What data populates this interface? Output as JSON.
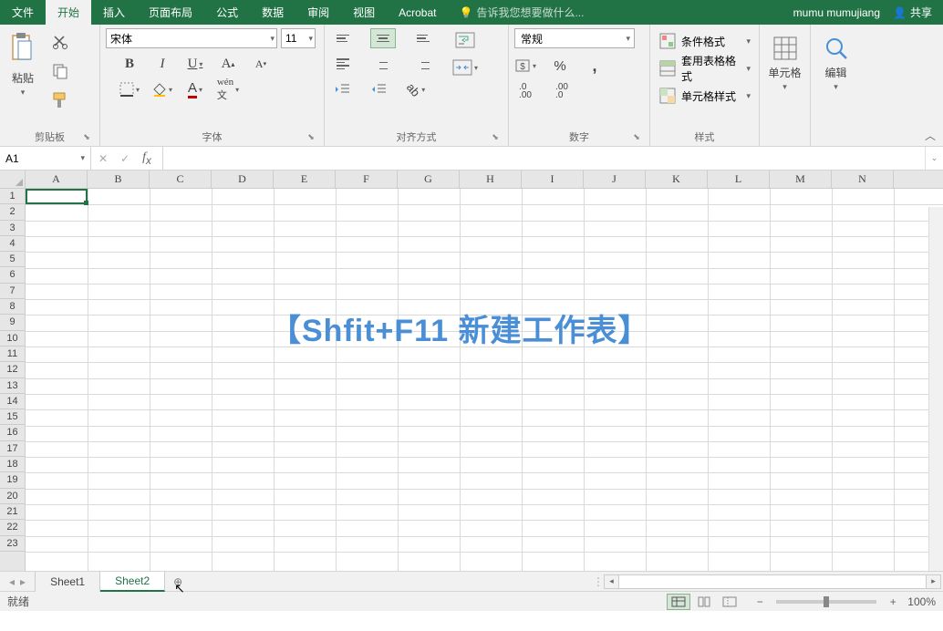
{
  "tabs": {
    "file": "文件",
    "home": "开始",
    "insert": "插入",
    "layout": "页面布局",
    "formula": "公式",
    "data": "数据",
    "review": "审阅",
    "view": "视图",
    "acrobat": "Acrobat"
  },
  "tell_me": "告诉我您想要做什么...",
  "user": "mumu mumujiang",
  "share": "共享",
  "clipboard": {
    "paste": "粘贴",
    "label": "剪贴板"
  },
  "font": {
    "name": "宋体",
    "size": "11",
    "label": "字体"
  },
  "alignment": {
    "label": "对齐方式"
  },
  "number": {
    "format": "常规",
    "label": "数字"
  },
  "styles": {
    "cond": "条件格式",
    "table": "套用表格格式",
    "cell": "单元格样式",
    "label": "样式"
  },
  "cells": {
    "label": "单元格"
  },
  "editing": {
    "label": "编辑"
  },
  "name_box": "A1",
  "columns": [
    "A",
    "B",
    "C",
    "D",
    "E",
    "F",
    "G",
    "H",
    "I",
    "J",
    "K",
    "L",
    "M",
    "N"
  ],
  "row_count": 23,
  "overlay": "【Shfit+F11 新建工作表】",
  "sheets": {
    "s1": "Sheet1",
    "s2": "Sheet2"
  },
  "status": "就绪",
  "zoom": "100%"
}
